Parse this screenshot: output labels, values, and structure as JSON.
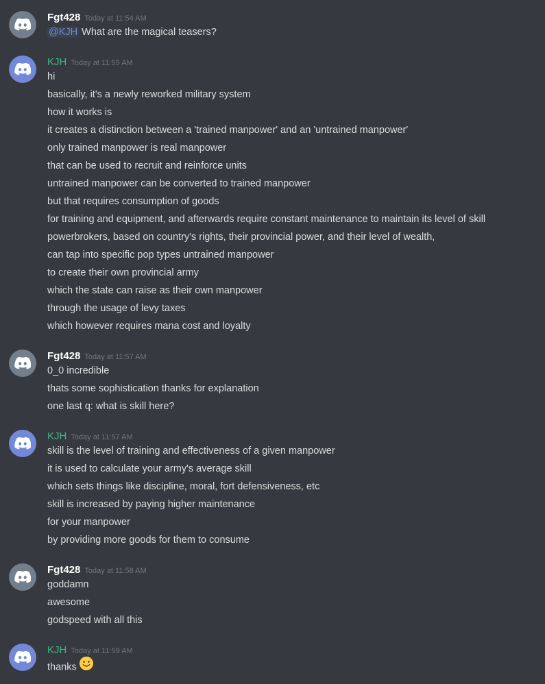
{
  "colors": {
    "background": "#36393f",
    "text": "#dcddde",
    "timestamp": "#72767d",
    "mention": "#7289da",
    "user_fgt": "#ffffff",
    "user_kjh": "#43b581",
    "avatar_grey": "#747f8d",
    "avatar_blurple": "#7289da"
  },
  "icons": {
    "avatar": "discord-logo-icon",
    "emoji": "slightly-smiling-face-icon"
  },
  "groups": [
    {
      "username": "Fgt428",
      "timestamp": "Today at 11:54 AM",
      "messages": [
        {
          "mention": "@KJH",
          "text": " What are the magical teasers?"
        }
      ]
    },
    {
      "username": "KJH",
      "timestamp": "Today at 11:55 AM",
      "messages": [
        {
          "text": "hi"
        },
        {
          "text": "basically, it's a newly reworked military system"
        },
        {
          "text": "how it works is"
        },
        {
          "text": "it creates a distinction between a 'trained manpower' and an 'untrained manpower'"
        },
        {
          "text": "only trained manpower is real manpower"
        },
        {
          "text": "that can be used to recruit and reinforce units"
        },
        {
          "text": "untrained manpower can be converted to trained manpower"
        },
        {
          "text": "but that requires consumption of goods"
        },
        {
          "text": "for training and equipment, and afterwards require constant maintenance to maintain its level of skill"
        },
        {
          "text": "powerbrokers, based on country's rights, their provincial power, and their level of wealth,"
        },
        {
          "text": "can tap into specific pop types untrained manpower"
        },
        {
          "text": "to create their own provincial army"
        },
        {
          "text": "which the state can raise as their own manpower"
        },
        {
          "text": "through the usage of levy taxes"
        },
        {
          "text": "which however requires mana cost and loyalty"
        }
      ]
    },
    {
      "username": "Fgt428",
      "timestamp": "Today at 11:57 AM",
      "messages": [
        {
          "text": "0_0 incredible"
        },
        {
          "text": "thats some sophistication thanks for explanation"
        },
        {
          "text": "one last q: what is skill here?"
        }
      ]
    },
    {
      "username": "KJH",
      "timestamp": "Today at 11:57 AM",
      "messages": [
        {
          "text": "skill is the level of training and effectiveness of a given manpower"
        },
        {
          "text": "it is used to calculate your army's average skill"
        },
        {
          "text": "which sets things like discipline, moral, fort defensiveness, etc"
        },
        {
          "text": "skill is increased by paying higher maintenance"
        },
        {
          "text": "for your manpower"
        },
        {
          "text": "by providing more goods for them to consume"
        }
      ]
    },
    {
      "username": "Fgt428",
      "timestamp": "Today at 11:58 AM",
      "messages": [
        {
          "text": "goddamn"
        },
        {
          "text": "awesome"
        },
        {
          "text": "godspeed with all this"
        }
      ]
    },
    {
      "username": "KJH",
      "timestamp": "Today at 11:59 AM",
      "messages": [
        {
          "text": "thanks"
        }
      ]
    }
  ]
}
